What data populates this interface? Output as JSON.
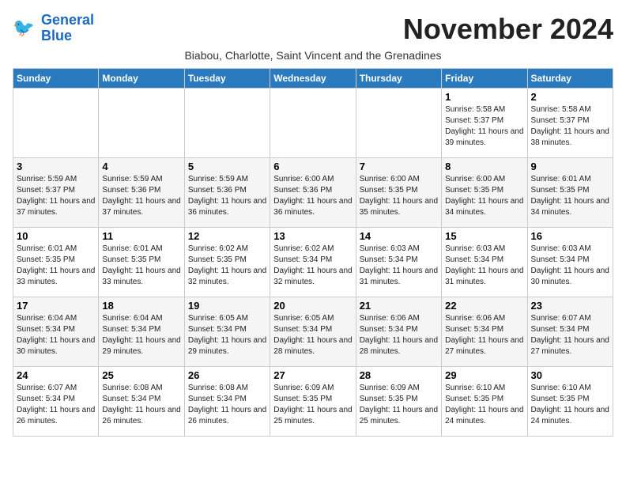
{
  "header": {
    "logo_line1": "General",
    "logo_line2": "Blue",
    "month_title": "November 2024",
    "subtitle": "Biabou, Charlotte, Saint Vincent and the Grenadines"
  },
  "days_of_week": [
    "Sunday",
    "Monday",
    "Tuesday",
    "Wednesday",
    "Thursday",
    "Friday",
    "Saturday"
  ],
  "weeks": [
    [
      {
        "day": "",
        "info": ""
      },
      {
        "day": "",
        "info": ""
      },
      {
        "day": "",
        "info": ""
      },
      {
        "day": "",
        "info": ""
      },
      {
        "day": "",
        "info": ""
      },
      {
        "day": "1",
        "info": "Sunrise: 5:58 AM\nSunset: 5:37 PM\nDaylight: 11 hours and 39 minutes."
      },
      {
        "day": "2",
        "info": "Sunrise: 5:58 AM\nSunset: 5:37 PM\nDaylight: 11 hours and 38 minutes."
      }
    ],
    [
      {
        "day": "3",
        "info": "Sunrise: 5:59 AM\nSunset: 5:37 PM\nDaylight: 11 hours and 37 minutes."
      },
      {
        "day": "4",
        "info": "Sunrise: 5:59 AM\nSunset: 5:36 PM\nDaylight: 11 hours and 37 minutes."
      },
      {
        "day": "5",
        "info": "Sunrise: 5:59 AM\nSunset: 5:36 PM\nDaylight: 11 hours and 36 minutes."
      },
      {
        "day": "6",
        "info": "Sunrise: 6:00 AM\nSunset: 5:36 PM\nDaylight: 11 hours and 36 minutes."
      },
      {
        "day": "7",
        "info": "Sunrise: 6:00 AM\nSunset: 5:35 PM\nDaylight: 11 hours and 35 minutes."
      },
      {
        "day": "8",
        "info": "Sunrise: 6:00 AM\nSunset: 5:35 PM\nDaylight: 11 hours and 34 minutes."
      },
      {
        "day": "9",
        "info": "Sunrise: 6:01 AM\nSunset: 5:35 PM\nDaylight: 11 hours and 34 minutes."
      }
    ],
    [
      {
        "day": "10",
        "info": "Sunrise: 6:01 AM\nSunset: 5:35 PM\nDaylight: 11 hours and 33 minutes."
      },
      {
        "day": "11",
        "info": "Sunrise: 6:01 AM\nSunset: 5:35 PM\nDaylight: 11 hours and 33 minutes."
      },
      {
        "day": "12",
        "info": "Sunrise: 6:02 AM\nSunset: 5:35 PM\nDaylight: 11 hours and 32 minutes."
      },
      {
        "day": "13",
        "info": "Sunrise: 6:02 AM\nSunset: 5:34 PM\nDaylight: 11 hours and 32 minutes."
      },
      {
        "day": "14",
        "info": "Sunrise: 6:03 AM\nSunset: 5:34 PM\nDaylight: 11 hours and 31 minutes."
      },
      {
        "day": "15",
        "info": "Sunrise: 6:03 AM\nSunset: 5:34 PM\nDaylight: 11 hours and 31 minutes."
      },
      {
        "day": "16",
        "info": "Sunrise: 6:03 AM\nSunset: 5:34 PM\nDaylight: 11 hours and 30 minutes."
      }
    ],
    [
      {
        "day": "17",
        "info": "Sunrise: 6:04 AM\nSunset: 5:34 PM\nDaylight: 11 hours and 30 minutes."
      },
      {
        "day": "18",
        "info": "Sunrise: 6:04 AM\nSunset: 5:34 PM\nDaylight: 11 hours and 29 minutes."
      },
      {
        "day": "19",
        "info": "Sunrise: 6:05 AM\nSunset: 5:34 PM\nDaylight: 11 hours and 29 minutes."
      },
      {
        "day": "20",
        "info": "Sunrise: 6:05 AM\nSunset: 5:34 PM\nDaylight: 11 hours and 28 minutes."
      },
      {
        "day": "21",
        "info": "Sunrise: 6:06 AM\nSunset: 5:34 PM\nDaylight: 11 hours and 28 minutes."
      },
      {
        "day": "22",
        "info": "Sunrise: 6:06 AM\nSunset: 5:34 PM\nDaylight: 11 hours and 27 minutes."
      },
      {
        "day": "23",
        "info": "Sunrise: 6:07 AM\nSunset: 5:34 PM\nDaylight: 11 hours and 27 minutes."
      }
    ],
    [
      {
        "day": "24",
        "info": "Sunrise: 6:07 AM\nSunset: 5:34 PM\nDaylight: 11 hours and 26 minutes."
      },
      {
        "day": "25",
        "info": "Sunrise: 6:08 AM\nSunset: 5:34 PM\nDaylight: 11 hours and 26 minutes."
      },
      {
        "day": "26",
        "info": "Sunrise: 6:08 AM\nSunset: 5:34 PM\nDaylight: 11 hours and 26 minutes."
      },
      {
        "day": "27",
        "info": "Sunrise: 6:09 AM\nSunset: 5:35 PM\nDaylight: 11 hours and 25 minutes."
      },
      {
        "day": "28",
        "info": "Sunrise: 6:09 AM\nSunset: 5:35 PM\nDaylight: 11 hours and 25 minutes."
      },
      {
        "day": "29",
        "info": "Sunrise: 6:10 AM\nSunset: 5:35 PM\nDaylight: 11 hours and 24 minutes."
      },
      {
        "day": "30",
        "info": "Sunrise: 6:10 AM\nSunset: 5:35 PM\nDaylight: 11 hours and 24 minutes."
      }
    ]
  ]
}
